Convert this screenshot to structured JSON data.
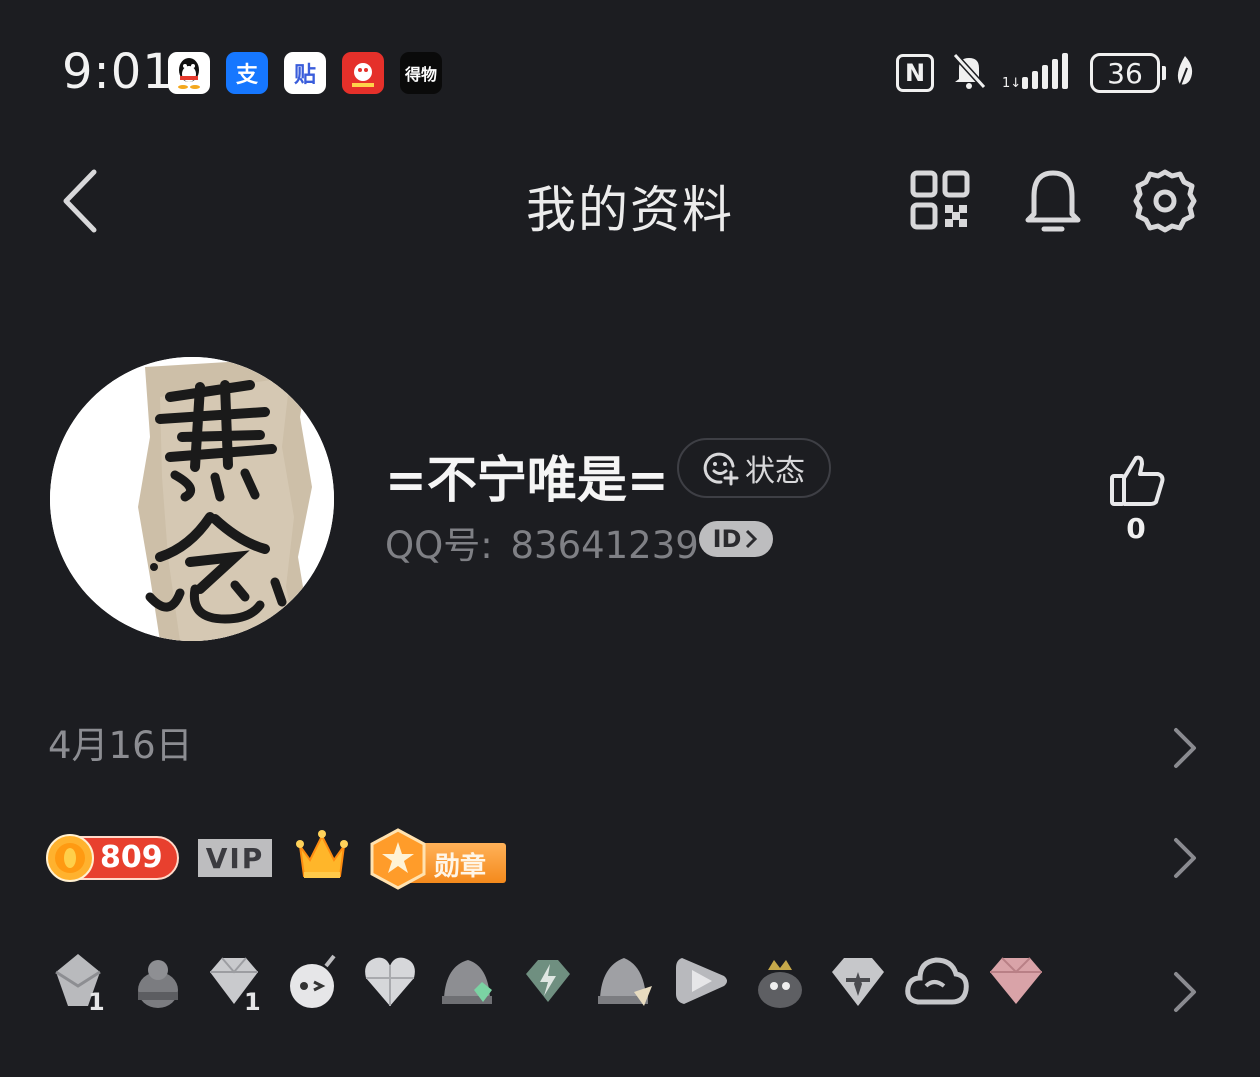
{
  "status_bar": {
    "time": "9:01",
    "app_icons": [
      {
        "name": "qq-icon",
        "glyph": "",
        "bg": "#ffffff",
        "fg": "#111111"
      },
      {
        "name": "alipay-icon",
        "glyph": "支",
        "bg": "#1677ff",
        "fg": "#ffffff"
      },
      {
        "name": "tieba-icon",
        "glyph": "贴",
        "bg": "#ffffff",
        "fg": "#3a5ddb"
      },
      {
        "name": "news-app-icon",
        "glyph": "",
        "bg": "#e5302a",
        "fg": "#ffffff"
      },
      {
        "name": "dewu-icon",
        "glyph": "得物",
        "bg": "#0a0a0a",
        "fg": "#ffffff"
      }
    ],
    "battery": "36"
  },
  "header": {
    "back_icon": "chevron-left-icon",
    "title": "我的资料",
    "right_icons": [
      "qr-code-icon",
      "bell-icon",
      "gear-icon"
    ]
  },
  "profile": {
    "nickname": "=不宁唯是=",
    "status_label": "状态",
    "qq_label": "QQ号:",
    "qq_number": "83641239",
    "id_badge": "ID",
    "likes": "0"
  },
  "details": {
    "birthday": "4月16日"
  },
  "badges_row": {
    "coin_value": "809",
    "vip_label": "VIP",
    "medal_label": "勋章"
  },
  "colors": {
    "background": "#1c1d21",
    "coin_red": "#e8402e",
    "medal_orange": "#f7931e",
    "muted_text": "#7f8085"
  }
}
